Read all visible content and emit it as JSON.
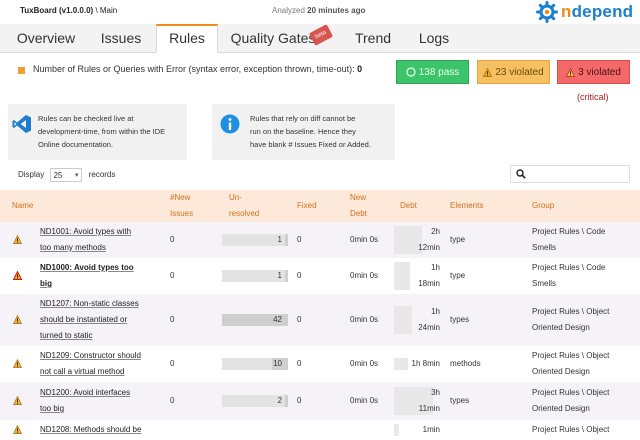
{
  "header": {
    "app_name": "TuxBoard (v1.0.0.0)",
    "branch": " \\ Main",
    "analyzed_prefix": "Analyzed ",
    "analyzed_time": "20 minutes ago",
    "logo_n": "n",
    "logo_rest": "depend"
  },
  "tabs": [
    {
      "label": "Overview"
    },
    {
      "label": "Issues"
    },
    {
      "label": "Rules",
      "active": true
    },
    {
      "label": "Quality Gates"
    },
    {
      "label": "Trend"
    },
    {
      "label": "Logs"
    }
  ],
  "beta_badge": "beta",
  "summary": {
    "error_label": "Number of Rules or Queries with Error (syntax error, exception thrown, time-out): ",
    "error_count": "0",
    "pass": "138 pass",
    "violated": "23 violated",
    "critical_violated": "3 violated",
    "critical_label": "(critical)"
  },
  "info": {
    "box1": [
      "Rules can be checked live at",
      "development-time, from within the IDE",
      "Online documentation."
    ],
    "box2": [
      "Rules that rely on diff cannot be",
      "run on the baseline. Hence they",
      "have blank # Issues Fixed or Added."
    ]
  },
  "display": {
    "prefix": "Display",
    "value": "25",
    "suffix": "records"
  },
  "search": {
    "placeholder": ""
  },
  "columns": {
    "name": "Name",
    "new_issues": [
      "#New",
      "Issues"
    ],
    "unresolved": [
      "Un-",
      "resolved"
    ],
    "fixed": "Fixed",
    "new_debt": [
      "New",
      "Debt"
    ],
    "debt": "Debt",
    "elements": "Elements",
    "group": "Group"
  },
  "rows": [
    {
      "name": [
        "ND1001: Avoid types with",
        "too many methods"
      ],
      "bold": false,
      "critical": false,
      "new_issues": "0",
      "unresolved": "1",
      "unresolved_frac": 0.04,
      "fixed": "0",
      "new_debt": "0min 0s",
      "debt": [
        "2h",
        "12min"
      ],
      "debt_frac": 0.6,
      "elements": "type",
      "group": [
        "Project Rules \\ Code",
        "Smells"
      ]
    },
    {
      "name": [
        "ND1000: Avoid types too",
        "big"
      ],
      "bold": true,
      "critical": true,
      "new_issues": "0",
      "unresolved": "1",
      "unresolved_frac": 0.04,
      "fixed": "0",
      "new_debt": "0min 0s",
      "debt": [
        "1h",
        "18min"
      ],
      "debt_frac": 0.35,
      "elements": "type",
      "group": [
        "Project Rules \\ Code",
        "Smells"
      ]
    },
    {
      "name": [
        "ND1207: Non-static classes",
        "should be instantiated or",
        "turned to static"
      ],
      "bold": false,
      "critical": false,
      "new_issues": "0",
      "unresolved": "42",
      "unresolved_frac": 1.0,
      "fixed": "0",
      "new_debt": "0min 0s",
      "debt": [
        "1h",
        "24min"
      ],
      "debt_frac": 0.4,
      "elements": "types",
      "group": [
        "Project Rules \\ Object",
        "Oriented Design"
      ]
    },
    {
      "name": [
        "ND1209: Constructor should",
        "not call a virtual method"
      ],
      "bold": false,
      "critical": false,
      "new_issues": "0",
      "unresolved": "10",
      "unresolved_frac": 0.24,
      "fixed": "0",
      "new_debt": "0min 0s",
      "debt": [
        "1h 8min"
      ],
      "debt_frac": 0.3,
      "elements": "methods",
      "group": [
        "Project Rules \\ Object",
        "Oriented Design"
      ]
    },
    {
      "name": [
        "ND1200: Avoid interfaces",
        "too big"
      ],
      "bold": false,
      "critical": false,
      "new_issues": "0",
      "unresolved": "2",
      "unresolved_frac": 0.05,
      "fixed": "0",
      "new_debt": "0min 0s",
      "debt": [
        "3h",
        "11min"
      ],
      "debt_frac": 0.85,
      "elements": "types",
      "group": [
        "Project Rules \\ Object",
        "Oriented Design"
      ]
    },
    {
      "name": [
        "ND1208: Methods should be"
      ],
      "bold": false,
      "critical": false,
      "new_issues": "",
      "unresolved": "",
      "unresolved_frac": 0,
      "fixed": "",
      "new_debt": "",
      "debt": [
        "1min"
      ],
      "debt_frac": 0.1,
      "elements": "",
      "group": [
        "Project Rules \\ Object"
      ]
    }
  ],
  "colors": {
    "accent": "#f08a1c",
    "pass": "#3cc46a",
    "warn": "#f6c060",
    "critical": "#f46a6a"
  }
}
